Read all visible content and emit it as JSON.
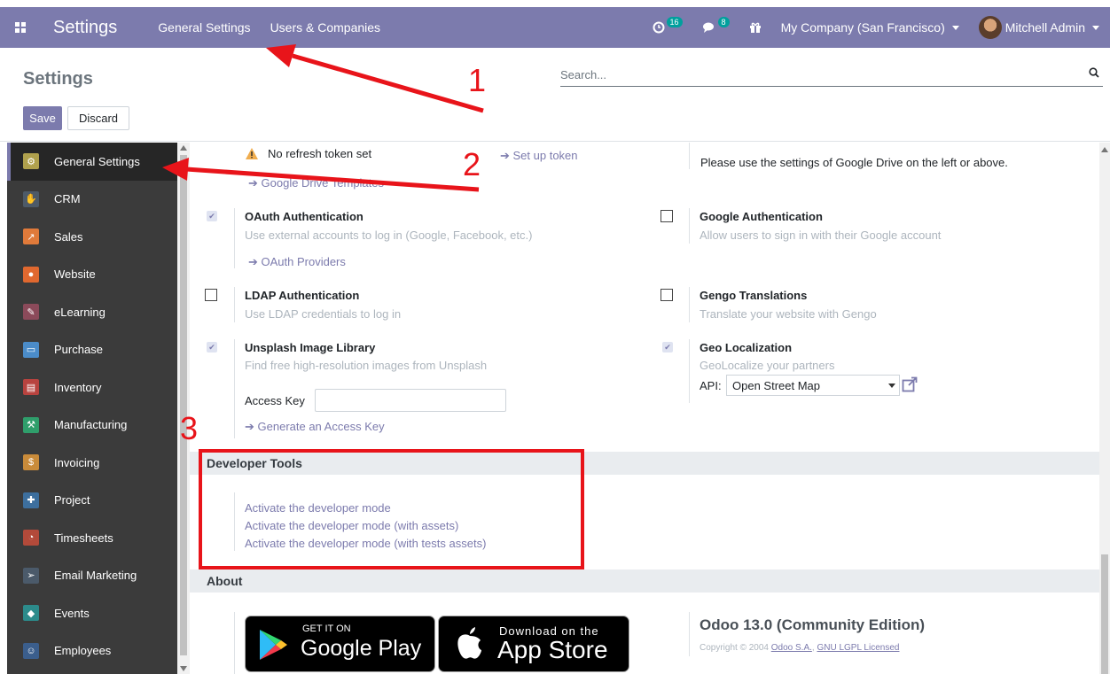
{
  "navbar": {
    "app_title": "Settings",
    "menu": [
      "General Settings",
      "Users & Companies"
    ],
    "activity_count": "16",
    "messages_count": "8",
    "company": "My Company (San Francisco)",
    "user": "Mitchell Admin"
  },
  "control_panel": {
    "title": "Settings",
    "save_label": "Save",
    "discard_label": "Discard",
    "search_placeholder": "Search..."
  },
  "sidebar": {
    "items": [
      {
        "label": "General Settings",
        "icon": "gear-icon",
        "color": "#b0a14d"
      },
      {
        "label": "CRM",
        "icon": "handshake-icon",
        "color": "#4d5a68"
      },
      {
        "label": "Sales",
        "icon": "chart-icon",
        "color": "#e07a3a"
      },
      {
        "label": "Website",
        "icon": "globe-icon",
        "color": "#e0682f"
      },
      {
        "label": "eLearning",
        "icon": "elearning-icon",
        "color": "#8b4a5a"
      },
      {
        "label": "Purchase",
        "icon": "card-icon",
        "color": "#4b8cc9"
      },
      {
        "label": "Inventory",
        "icon": "box-icon",
        "color": "#b8433f"
      },
      {
        "label": "Manufacturing",
        "icon": "wrench-icon",
        "color": "#2f9e6b"
      },
      {
        "label": "Invoicing",
        "icon": "invoice-icon",
        "color": "#c98b3a"
      },
      {
        "label": "Project",
        "icon": "puzzle-icon",
        "color": "#3d6f9e"
      },
      {
        "label": "Timesheets",
        "icon": "stopwatch-icon",
        "color": "#b34a3a"
      },
      {
        "label": "Email Marketing",
        "icon": "paper-plane-icon",
        "color": "#4b5a6a"
      },
      {
        "label": "Events",
        "icon": "ticket-icon",
        "color": "#2c8b8b"
      },
      {
        "label": "Employees",
        "icon": "users-icon",
        "color": "#3b5e8c"
      }
    ]
  },
  "main": {
    "token_warning": "No refresh token set",
    "set_up_token": "Set up token",
    "google_drive_templates": "Google Drive Templates",
    "google_drive_note": "Please use the settings of Google Drive on the left or above.",
    "oauth": {
      "label": "OAuth Authentication",
      "desc": "Use external accounts to log in (Google, Facebook, etc.)",
      "link": "OAuth Providers",
      "checked": true
    },
    "google_auth": {
      "label": "Google Authentication",
      "desc": "Allow users to sign in with their Google account",
      "checked": false
    },
    "ldap": {
      "label": "LDAP Authentication",
      "desc": "Use LDAP credentials to log in",
      "checked": false
    },
    "gengo": {
      "label": "Gengo Translations",
      "desc": "Translate your website with Gengo",
      "checked": false
    },
    "unsplash": {
      "label": "Unsplash Image Library",
      "desc": "Find free high-resolution images from Unsplash",
      "access_key_label": "Access Key",
      "access_key_value": "",
      "link": "Generate an Access Key",
      "checked": true
    },
    "geo": {
      "label": "Geo Localization",
      "desc": "GeoLocalize your partners",
      "api_label": "API:",
      "api_value": "Open Street Map",
      "checked": true
    },
    "developer_tools": {
      "title": "Developer Tools",
      "links": [
        "Activate the developer mode",
        "Activate the developer mode (with assets)",
        "Activate the developer mode (with tests assets)"
      ]
    },
    "about": {
      "title": "About",
      "google_play_top": "GET IT ON",
      "google_play_bottom": "Google Play",
      "app_store_top": "Download on the",
      "app_store_bottom": "App Store",
      "version": "Odoo 13.0 (Community Edition)",
      "copyright": "Copyright © 2004",
      "company_link": "Odoo S.A.",
      "license_link": "GNU LGPL Licensed"
    }
  },
  "annotations": [
    "1",
    "2",
    "3"
  ],
  "colors": {
    "brand": "#7c7bad",
    "annotation": "#e8141a",
    "sidebar_bg": "#3b3b3b"
  }
}
